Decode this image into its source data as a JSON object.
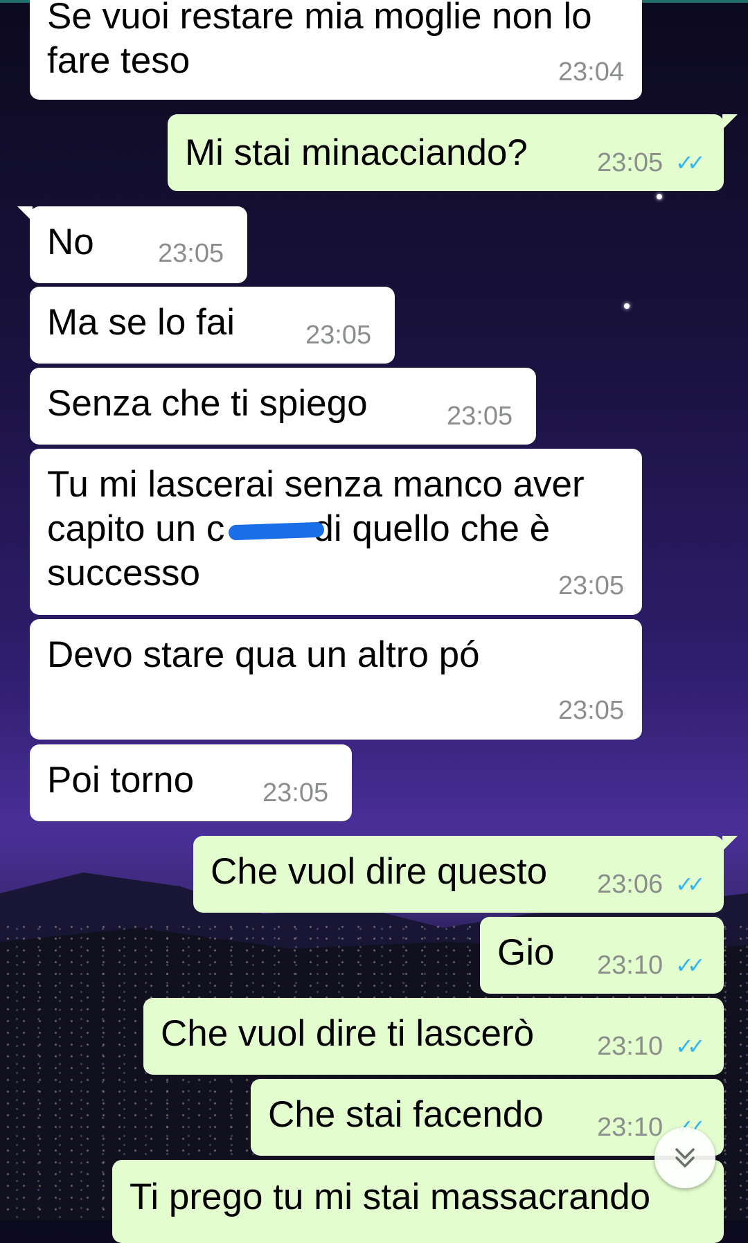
{
  "messages": [
    {
      "direction": "in",
      "text_lines": [
        "Se vuoi restare mia moglie non lo",
        "fare teso"
      ],
      "time": "23:04"
    },
    {
      "direction": "out",
      "text": "Mi stai minacciando?",
      "time": "23:05",
      "status": "read"
    },
    {
      "direction": "in",
      "text": "No",
      "time": "23:05"
    },
    {
      "direction": "in",
      "text": "Ma se lo fai",
      "time": "23:05"
    },
    {
      "direction": "in",
      "text": "Senza che ti spiego",
      "time": "23:05"
    },
    {
      "direction": "in",
      "text_lines": [
        "Tu mi lascerai senza manco aver",
        "capito un c",
        "di quello che è",
        "successo"
      ],
      "time": "23:05",
      "redacted": true
    },
    {
      "direction": "in",
      "text": "Devo stare qua un altro pó",
      "time": "23:05"
    },
    {
      "direction": "in",
      "text": "Poi torno",
      "time": "23:05"
    },
    {
      "direction": "out",
      "text": "Che vuol dire questo",
      "time": "23:06",
      "status": "read"
    },
    {
      "direction": "out",
      "text": "Gio",
      "time": "23:10",
      "status": "read"
    },
    {
      "direction": "out",
      "text": "Che vuol dire ti lascerò",
      "time": "23:10",
      "status": "read"
    },
    {
      "direction": "out",
      "text": "Che stai facendo",
      "time": "23:10",
      "status": "read"
    },
    {
      "direction": "out",
      "text": "Ti prego tu mi stai massacrando",
      "time": "",
      "status": ""
    }
  ],
  "colors": {
    "incoming_bubble": "#ffffff",
    "outgoing_bubble": "#e3fdcf",
    "read_ticks": "#34b7f1",
    "timestamp": "#8b8f8b",
    "redaction": "#1a6ee8"
  },
  "icons": {
    "read_receipt": "double-check-icon",
    "scroll_down": "chevron-double-down-icon"
  }
}
